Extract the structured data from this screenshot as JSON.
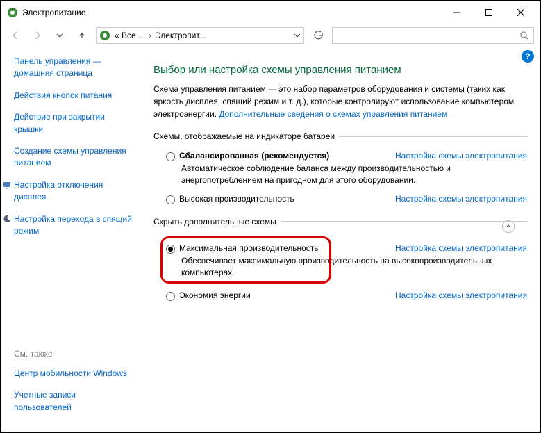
{
  "window": {
    "title": "Электропитание"
  },
  "breadcrumb": {
    "root": "« Все ...",
    "current": "Электропит..."
  },
  "sidebar": {
    "home": "Панель управления — домашняя страница",
    "items": [
      "Действия кнопок питания",
      "Действие при закрытии крышки",
      "Создание схемы управления питанием",
      "Настройка отключения дисплея",
      "Настройка перехода в спящий режим"
    ],
    "see_also_hdr": "См. также",
    "see_also": [
      "Центр мобильности Windows",
      "Учетные записи пользователей"
    ]
  },
  "content": {
    "heading": "Выбор или настройка схемы управления питанием",
    "intro": "Схема управления питанием — это набор параметров оборудования и системы (таких как яркость дисплея, спящий режим и т. д.), которые контролируют использование компьютером электроэнергии. ",
    "intro_link": "Дополнительные сведения о схемах управления питанием",
    "legend1": "Схемы, отображаемые на индикаторе батареи",
    "legend2": "Скрыть дополнительные схемы",
    "link": "Настройка схемы электропитания",
    "plans": {
      "balanced": {
        "name": "Сбалансированная (рекомендуется)",
        "desc": "Автоматическое соблюдение баланса между производительностью и энергопотреблением на пригодном для этого оборудовании."
      },
      "high": {
        "name": "Высокая производительность"
      },
      "ultimate": {
        "name": "Максимальная производительность",
        "desc": "Обеспечивает максимальную производительность на высокопроизводительных компьютерах."
      },
      "saver": {
        "name": "Экономия энергии"
      }
    }
  }
}
